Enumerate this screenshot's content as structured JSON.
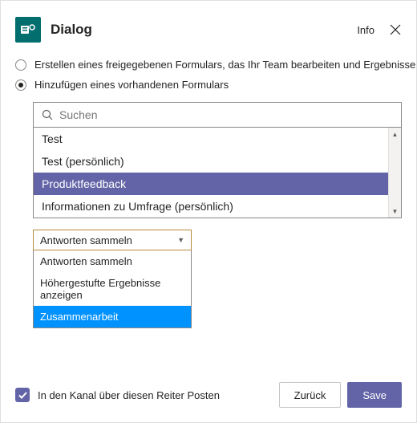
{
  "header": {
    "title": "Dialog",
    "info_label": "Info"
  },
  "radios": {
    "create_label": "Erstellen eines freigegebenen Formulars, das Ihr Team bearbeiten und Ergebnisse anzeigen kann",
    "add_label": "Hinzufügen eines vorhandenen Formulars"
  },
  "search": {
    "placeholder": "Suchen"
  },
  "list": {
    "items": [
      {
        "label": "Test"
      },
      {
        "label": "Test (persönlich)"
      },
      {
        "label": "Produktfeedback"
      },
      {
        "label": "Informationen zu Umfrage (persönlich)"
      }
    ]
  },
  "select": {
    "value": "Antworten sammeln",
    "options": [
      {
        "label": "Antworten sammeln"
      },
      {
        "label": "Höhergestufte Ergebnisse anzeigen"
      },
      {
        "label": "Zusammenarbeit"
      }
    ]
  },
  "footer": {
    "checkbox_label": "In den Kanal über diesen Reiter Posten",
    "back_label": "Zurück",
    "save_label": "Save"
  }
}
